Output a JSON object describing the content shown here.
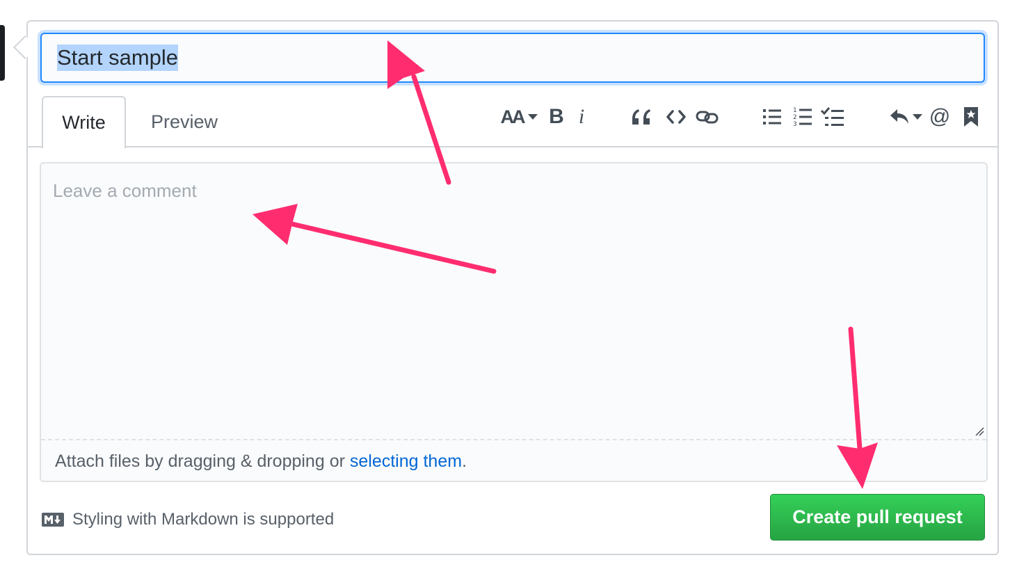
{
  "title_field": {
    "value": "Start sample"
  },
  "tabs": [
    {
      "label": "Write",
      "active": true
    },
    {
      "label": "Preview",
      "active": false
    }
  ],
  "toolbar": [
    {
      "name": "text-size-icon",
      "glyph": "AA"
    },
    {
      "name": "bold-icon",
      "glyph": "B"
    },
    {
      "name": "italic-icon",
      "glyph": "i"
    },
    {
      "name": "quote-icon"
    },
    {
      "name": "code-icon"
    },
    {
      "name": "link-icon"
    },
    {
      "name": "unordered-list-icon"
    },
    {
      "name": "ordered-list-icon"
    },
    {
      "name": "task-list-icon"
    },
    {
      "name": "reply-icon"
    },
    {
      "name": "mention-icon",
      "glyph": "@"
    },
    {
      "name": "bookmark-icon"
    }
  ],
  "comment": {
    "placeholder": "Leave a comment",
    "attach_prefix": "Attach files by dragging & dropping or ",
    "attach_link": "selecting them",
    "attach_suffix": "."
  },
  "footer": {
    "markdown_note": "Styling with Markdown is supported",
    "submit_label": "Create pull request"
  },
  "colors": {
    "accent": "#0366d6",
    "submit_green": "#28a745",
    "annotation_arrow": "#ff2d6f"
  }
}
